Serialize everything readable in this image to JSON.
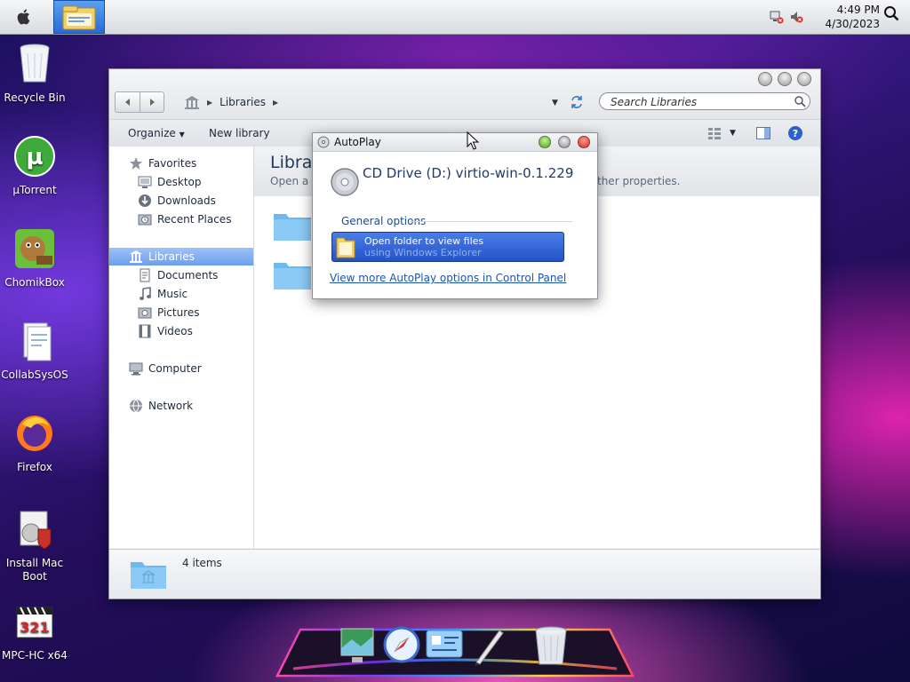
{
  "menubar": {
    "clock": {
      "time": "4:49 PM",
      "date": "4/30/2023"
    },
    "icons": [
      "apple-icon",
      "file-explorer-icon",
      "network-tray-icon",
      "volume-tray-icon",
      "search-icon"
    ]
  },
  "desktop": {
    "icons": [
      {
        "label": "Recycle Bin",
        "icon": "recycle-bin-icon"
      },
      {
        "label": "µTorrent",
        "icon": "utorrent-icon"
      },
      {
        "label": "ChomikBox",
        "icon": "chomikbox-icon"
      },
      {
        "label": "CollabSysOS",
        "icon": "document-icon"
      },
      {
        "label": "Firefox",
        "icon": "firefox-icon"
      },
      {
        "label": "Install Mac Boot",
        "icon": "installer-icon"
      },
      {
        "label": "MPC-HC x64",
        "icon": "media-player-icon"
      }
    ]
  },
  "explorer": {
    "breadcrumb": [
      "Libraries"
    ],
    "search_placeholder": "Search Libraries",
    "toolbar": {
      "organize": "Organize",
      "new_library": "New library"
    },
    "sidebar": {
      "favorites": {
        "label": "Favorites",
        "items": [
          "Desktop",
          "Downloads",
          "Recent Places"
        ]
      },
      "libraries": {
        "label": "Libraries",
        "items": [
          "Documents",
          "Music",
          "Pictures",
          "Videos"
        ]
      },
      "computer": "Computer",
      "network": "Network"
    },
    "content": {
      "title": "Librar",
      "subtitle": "Open a li",
      "subtitle_tail": "ther properties."
    },
    "status": {
      "count": "4 items"
    }
  },
  "autoplay": {
    "title": "AutoPlay",
    "drive": "CD Drive (D:) virtio-win-0.1.229",
    "section": "General options",
    "option": {
      "line1": "Open folder to view files",
      "line2": "using Windows Explorer"
    },
    "link": "View more AutoPlay options in Control Panel"
  },
  "dock": {
    "icons": [
      "desktop-preview-icon",
      "safari-icon",
      "preferences-icon",
      "pen-icon",
      "trash-icon"
    ]
  }
}
